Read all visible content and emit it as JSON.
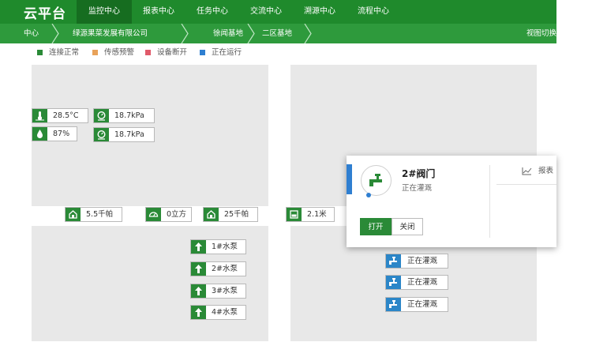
{
  "header": {
    "brand": "云平台",
    "nav": [
      "监控中心",
      "报表中心",
      "任务中心",
      "交流中心",
      "溯源中心",
      "流程中心"
    ]
  },
  "breadcrumb": {
    "items": [
      "中心",
      "绿源果菜发展有限公司",
      "徐闻基地",
      "二区基地"
    ],
    "view_switch": "视图切换"
  },
  "legend": [
    {
      "label": "连接正常",
      "color": "#2a8a37"
    },
    {
      "label": "传感预警",
      "color": "#e8a25a"
    },
    {
      "label": "设备断开",
      "color": "#e05a6a"
    },
    {
      "label": "正在运行",
      "color": "#2f7fd1"
    }
  ],
  "sensors": {
    "temperature": "28.5°C",
    "humidity": "87%",
    "pressure_1": "18.7kPa",
    "pressure_2": "18.7kPa",
    "soil_1": "5.5千帕",
    "volume": "0立方",
    "soil_2": "25千帕",
    "level": "2.1米"
  },
  "pumps": [
    "1#水泵",
    "2#水泵",
    "3#水泵",
    "4#水泵"
  ],
  "valves": [
    "正在灌溉",
    "正在灌溉",
    "正在灌溉"
  ],
  "popup": {
    "title": "2#阀门",
    "status": "正在灌溉",
    "report": "报表",
    "open": "打开",
    "close": "关闭"
  }
}
